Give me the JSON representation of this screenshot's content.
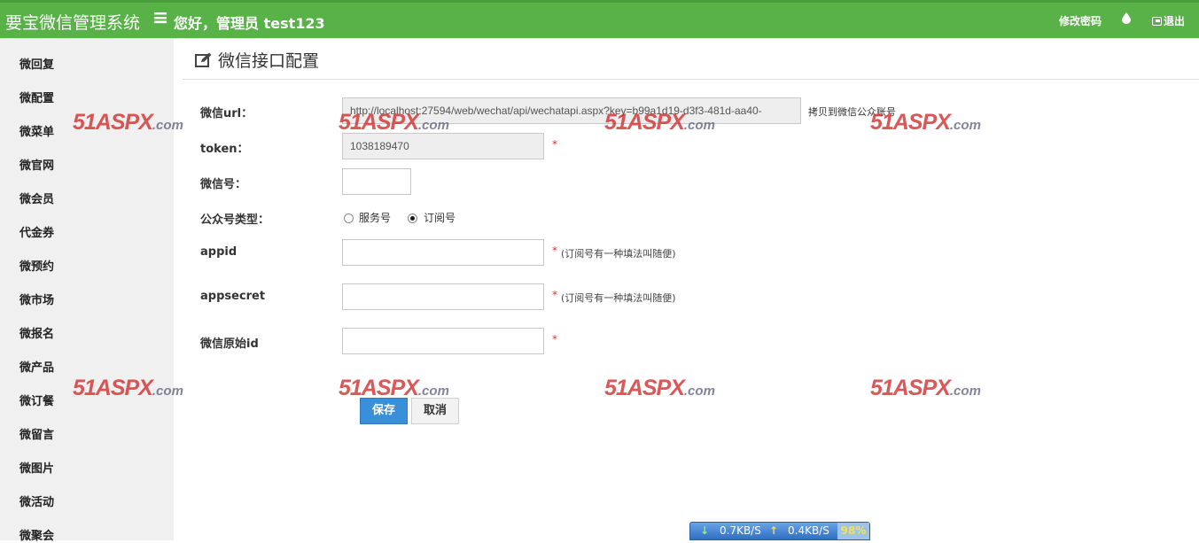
{
  "header": {
    "brand": "要宝微信管理系统",
    "menu_glyph": "≡",
    "greeting": "您好，管理员 test123",
    "change_password": "修改密码",
    "drop_glyph": "💧",
    "logout": "退出"
  },
  "sidebar": {
    "items": [
      "微回复",
      "微配置",
      "微菜单",
      "微官网",
      "微会员",
      "代金券",
      "微预约",
      "微市场",
      "微报名",
      "微产品",
      "微订餐",
      "微留言",
      "微图片",
      "微活动",
      "微聚会"
    ]
  },
  "page": {
    "title": "微信接口配置"
  },
  "form": {
    "url_label": "微信url：",
    "url_value": "http://localhost:27594/web/wechat/api/wechatapi.aspx?key=b99a1d19-d3f3-481d-aa40-",
    "url_copy_hint": "拷贝到微信公众账号",
    "token_label": "token：",
    "token_value": "1038189470",
    "wechat_id_label": "微信号：",
    "wechat_id_value": "",
    "account_type_label": "公众号类型：",
    "account_type_options": [
      "服务号",
      "订阅号"
    ],
    "account_type_selected": "订阅号",
    "appid_label": "appid",
    "appid_value": "",
    "appid_hint": "(订阅号有一种填法叫随便)",
    "appsecret_label": "appsecret",
    "appsecret_value": "",
    "appsecret_hint": "(订阅号有一种填法叫随便)",
    "original_id_label": "微信原始id",
    "original_id_value": "",
    "required_mark": "*",
    "save_label": "保存",
    "cancel_label": "取消"
  },
  "watermark": {
    "main": "51ASPX",
    "sub": ".com"
  },
  "netbar": {
    "down_arrow": "↓",
    "down_speed": "0.7KB/S",
    "up_arrow": "↑",
    "up_speed": "0.4KB/S",
    "percent": "98%"
  },
  "colors": {
    "header_green": "#58b248",
    "save_blue": "#3a8fd9",
    "required_red": "#e2322c"
  }
}
